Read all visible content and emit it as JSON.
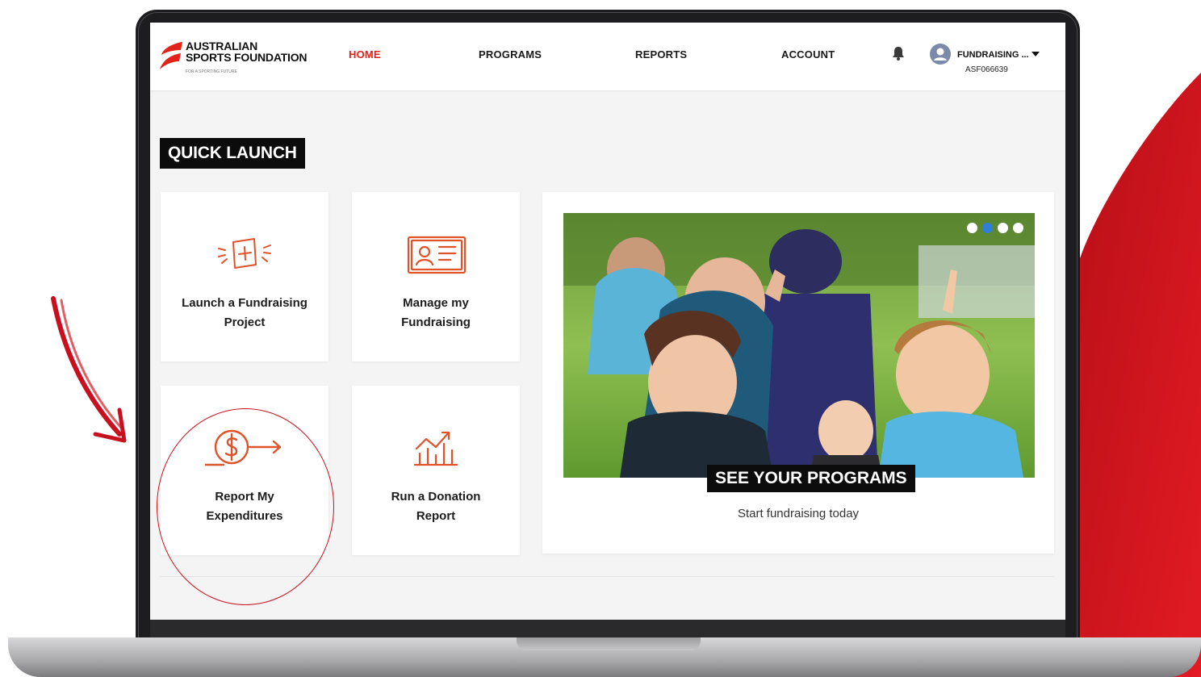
{
  "header": {
    "logo_line1": "AUSTRALIAN",
    "logo_line2": "SPORTS FOUNDATION",
    "logo_tagline": "FOR A SPORTING FUTURE",
    "nav": [
      "HOME",
      "PROGRAMS",
      "REPORTS",
      "ACCOUNT"
    ],
    "active_nav": "HOME",
    "user_name": "FUNDRAISING ...",
    "user_id": "ASF066639"
  },
  "quick_launch": {
    "title": "QUICK LAUNCH",
    "tiles": [
      {
        "line1": "Launch a Fundraising",
        "line2": "Project",
        "icon": "add-project-icon"
      },
      {
        "line1": "Manage my",
        "line2": "Fundraising",
        "icon": "id-card-icon"
      },
      {
        "line1": "Report My",
        "line2": "Expenditures",
        "icon": "dollar-arrow-icon"
      },
      {
        "line1": "Run a Donation",
        "line2": "Report",
        "icon": "chart-growth-icon"
      }
    ]
  },
  "carousel": {
    "title": "SEE YOUR PROGRAMS",
    "subtitle": "Start fundraising today",
    "slides": 4,
    "active_slide": 2
  },
  "colors": {
    "brand_red": "#e2231a",
    "accent_orange": "#e0522a",
    "annotation_red": "#c8101e",
    "carousel_active_dot": "#2f7fd6"
  }
}
